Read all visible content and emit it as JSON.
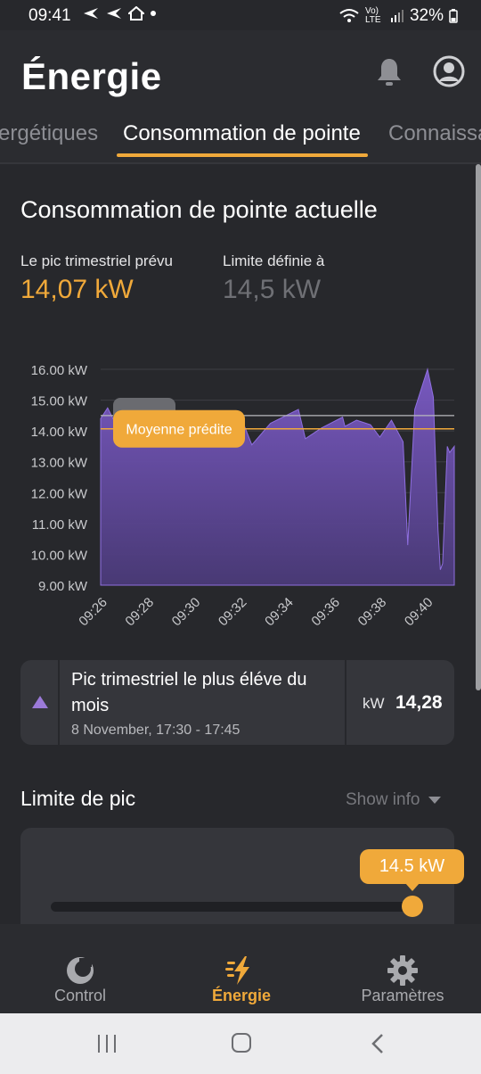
{
  "status_bar": {
    "time": "09:41",
    "network": "Vo) LTE",
    "battery": "32%"
  },
  "header": {
    "title": "Énergie",
    "tabs": [
      {
        "label": "ergétiques",
        "active": false
      },
      {
        "label": "Consommation de pointe",
        "active": true
      },
      {
        "label": "Connaissa",
        "active": false
      }
    ]
  },
  "current_peak": {
    "title": "Consommation de pointe actuelle",
    "predicted_label": "Le pic trimestriel prévu",
    "predicted_value": "14,07 kW",
    "limit_label": "Limite définie à",
    "limit_value": "14,5 kW"
  },
  "chart_data": {
    "type": "area",
    "y_tick_labels": [
      "16.00 kW",
      "15.00 kW",
      "14.00 kW",
      "13.00 kW",
      "12.00 kW",
      "11.00 kW",
      "10.00 kW",
      "9.00 kW"
    ],
    "x_tick_labels": [
      "09:26",
      "09:28",
      "09:30",
      "09:32",
      "09:34",
      "09:36",
      "09:38",
      "09:40"
    ],
    "ylim": [
      9.0,
      16.0
    ],
    "x_range_minutes": [
      0,
      15.0
    ],
    "x_origin_label": "09:26",
    "limit_line": 14.5,
    "predicted_average_line": 14.07,
    "overlay_label": "Moyenne prédite",
    "points": [
      [
        0.0,
        14.4
      ],
      [
        0.3,
        14.75
      ],
      [
        0.6,
        14.3
      ],
      [
        1.2,
        14.5
      ],
      [
        2.0,
        14.35
      ],
      [
        3.0,
        14.5
      ],
      [
        4.0,
        14.3
      ],
      [
        5.0,
        14.45
      ],
      [
        6.0,
        14.5
      ],
      [
        6.5,
        13.55
      ],
      [
        7.3,
        14.25
      ],
      [
        8.5,
        14.7
      ],
      [
        8.8,
        13.75
      ],
      [
        9.5,
        14.1
      ],
      [
        10.4,
        14.45
      ],
      [
        10.5,
        14.15
      ],
      [
        11.0,
        14.35
      ],
      [
        11.6,
        14.2
      ],
      [
        12.0,
        13.8
      ],
      [
        12.5,
        14.35
      ],
      [
        13.0,
        13.65
      ],
      [
        13.2,
        10.3
      ],
      [
        13.5,
        14.7
      ],
      [
        14.05,
        16.0
      ],
      [
        14.3,
        15.1
      ],
      [
        14.5,
        10.8
      ],
      [
        14.6,
        9.5
      ],
      [
        14.7,
        9.7
      ],
      [
        14.9,
        13.5
      ],
      [
        15.0,
        13.3
      ],
      [
        15.2,
        13.5
      ]
    ],
    "series_color": "#7c5bc7"
  },
  "peak_card": {
    "title": "Pic trimestriel le plus éléve du mois",
    "date": "8 November, 17:30 - 17:45",
    "unit": "kW",
    "value": "14,28",
    "icon": "triangle-up-icon"
  },
  "peak_limit": {
    "title": "Limite de pic",
    "show_info_label": "Show info",
    "slider_value_label": "14.5 kW",
    "slider_fraction": 0.97
  },
  "bottom_nav": [
    {
      "label": "Control",
      "icon": "power-icon",
      "active": false
    },
    {
      "label": "Énergie",
      "icon": "lightning-icon",
      "active": true
    },
    {
      "label": "Paramètres",
      "icon": "gear-icon",
      "active": false
    }
  ],
  "colors": {
    "accent": "#f0a93a",
    "background": "#27282c",
    "surface": "#35363b",
    "chart_fill": "#7c5bc7"
  }
}
